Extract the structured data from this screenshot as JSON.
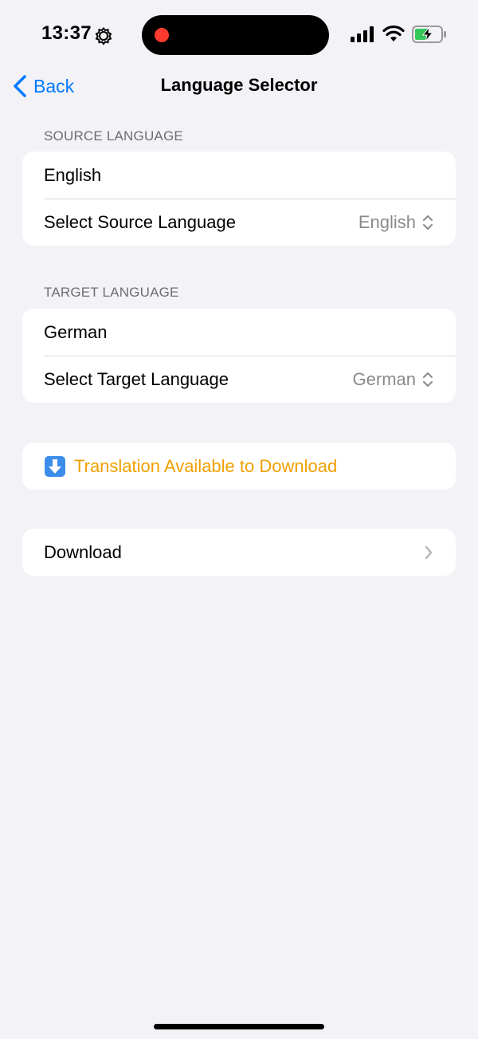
{
  "status_bar": {
    "time": "13:37"
  },
  "nav": {
    "back_label": "Back",
    "title": "Language Selector"
  },
  "source": {
    "header": "SOURCE LANGUAGE",
    "current": "English",
    "picker_label": "Select Source Language",
    "picker_value": "English"
  },
  "target": {
    "header": "TARGET LANGUAGE",
    "current": "German",
    "picker_label": "Select Target Language",
    "picker_value": "German"
  },
  "status": {
    "text": "Translation Available to Download",
    "icon": "download-arrow-icon",
    "color": "#F0A000"
  },
  "actions": {
    "download_label": "Download"
  },
  "colors": {
    "accent": "#007AFF",
    "background": "#F2F2F7",
    "secondary_text": "#8A8A8E",
    "recording": "#FF3B30",
    "battery_charging": "#34C759"
  }
}
